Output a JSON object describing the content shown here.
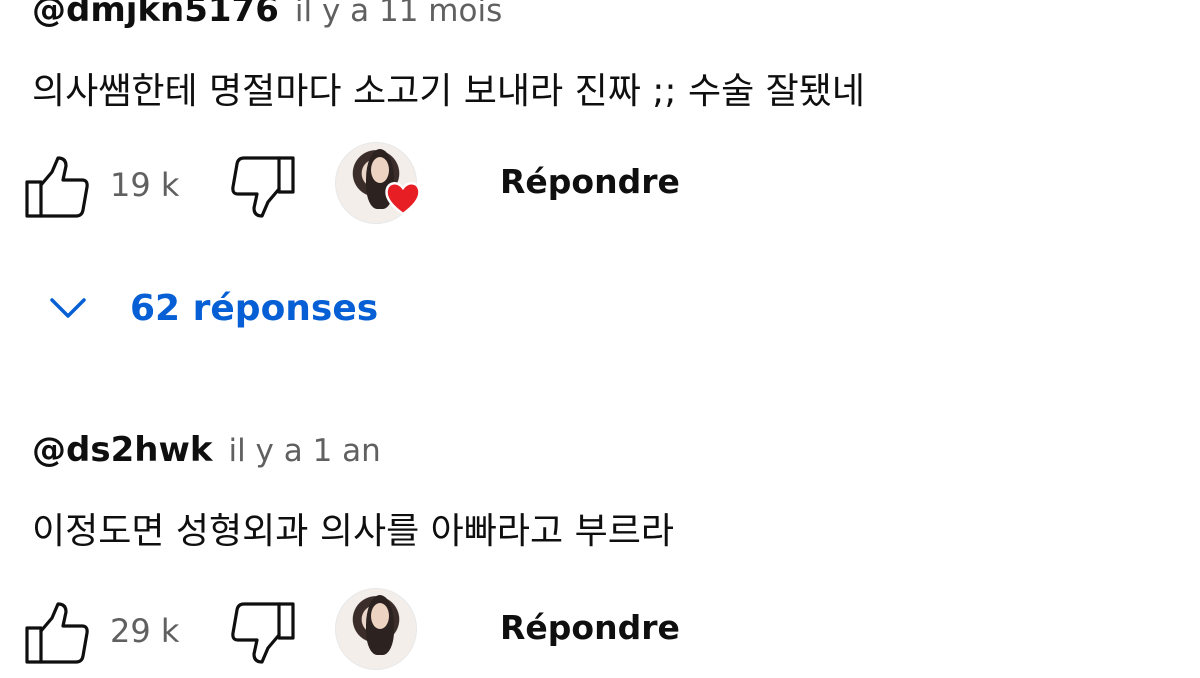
{
  "comments": [
    {
      "username": "@dmjkn5176",
      "timestamp": "il y a 11 mois",
      "text": "의사쌤한테 명절마다 소고기 보내라 진짜 ;; 수술 잘됐네",
      "likes": "19 k",
      "reply_label": "Répondre",
      "replies_label": "62 réponses"
    },
    {
      "username": "@ds2hwk",
      "timestamp": "il y a 1 an",
      "text": "이정도면 성형외과 의사를 아빠라고 부르라",
      "likes": "29 k",
      "reply_label": "Répondre"
    }
  ],
  "icons": {
    "like": "thumbs-up-icon",
    "dislike": "thumbs-down-icon",
    "chevron": "chevron-down-icon",
    "heart": "heart-icon"
  },
  "colors": {
    "link_blue": "#065fd4",
    "heart_red": "#e81e25",
    "muted_gray": "#606060"
  }
}
